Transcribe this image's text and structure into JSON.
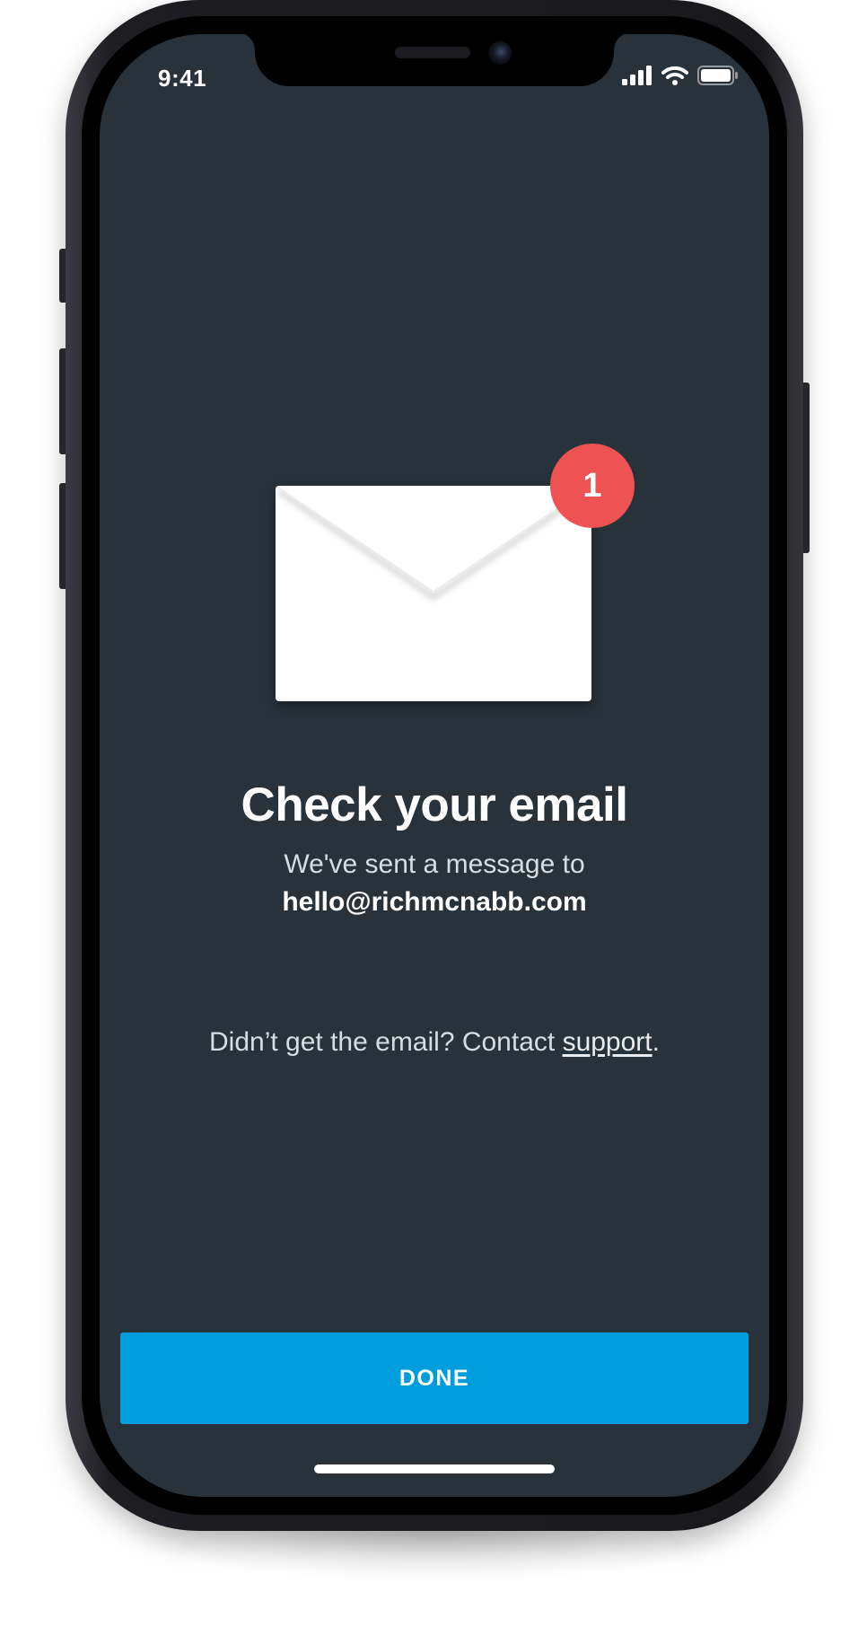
{
  "status_bar": {
    "time": "9:41",
    "icons": [
      "cellular-signal-icon",
      "wifi-icon",
      "battery-icon"
    ]
  },
  "illustration": {
    "icon": "envelope-icon",
    "badge_count": "1",
    "badge_color": "#ee5252"
  },
  "content": {
    "title": "Check your email",
    "subtitle": "We've sent a message to",
    "email": "hello@richmcnabb.com",
    "help_prefix": "Didn’t get the email? Contact ",
    "help_link": "support",
    "help_suffix": "."
  },
  "actions": {
    "done_label": "DONE"
  },
  "colors": {
    "screen_background": "#28323a",
    "accent": "#009ddc"
  }
}
